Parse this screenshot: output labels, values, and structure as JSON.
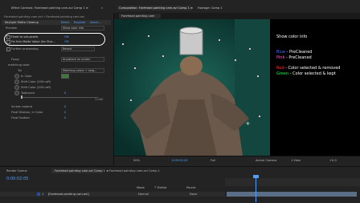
{
  "top_bar": {
    "left_tab": "Effect Controls: Forehead painting cam.avi Comp 1 ≡",
    "left_menu": "»",
    "comp_tab": "Composition: Forehead painting cam.avi Comp 1 ≡",
    "footage_tab": "Footage: Comp 1",
    "viewer_tab": "Forehead painting cam"
  },
  "effect": {
    "header": "Forehead painting cam.avi • Forehead painting cam.avi",
    "name": "Keylight Matte Cleanup",
    "reset": "Reset",
    "register": "Register",
    "about": "About...",
    "rows": [
      {
        "label": "Preview",
        "value": "Show color info"
      },
      {
        "label": "Fixed to sub-pixels",
        "value": "ON"
      },
      {
        "label": "Fix thin Matte Value (for Stro...",
        "value": "ON"
      },
      {
        "label": "Further processing",
        "value": "Reveal"
      },
      {
        "label": "Fuzzy",
        "value": "Anywhere on screen"
      },
      {
        "label": "matching color",
        "value": ""
      },
      {
        "label": "Tol",
        "value": "Matching colors + neig..."
      },
      {
        "label": "In Color",
        "value": ""
      },
      {
        "label": "Shift Color (200=off)",
        "value": ""
      },
      {
        "label": "Shift Color (200=off)",
        "value": ""
      },
      {
        "label": "Tolerance",
        "value": "0"
      },
      {
        "label": "",
        "value": "1.000"
      },
      {
        "label": "Screen extend",
        "value": "0"
      },
      {
        "label": "Final Dilation, in Color",
        "value": "0"
      },
      {
        "label": "Final Feather",
        "value": "0"
      }
    ]
  },
  "overlay": {
    "title": "Show color info",
    "items": [
      {
        "key": "Blue",
        "text": " - PreCleaned",
        "color": "#3f6bff"
      },
      {
        "key": "Pink",
        "text": " - PreCleaned",
        "color": "#ff5ac8"
      },
      {
        "key": "Red",
        "text": " - Color selected & removed",
        "color": "#ff2a2a"
      },
      {
        "key": "Green",
        "text": " - Color selected & kept",
        "color": "#2ee64b"
      }
    ]
  },
  "viewer_footer": {
    "zoom": "50%",
    "time": "0:00:02:05",
    "resolution": "Full",
    "camera": "Active Camera",
    "views": "1 View",
    "offset": "+0.0"
  },
  "timeline": {
    "tab1": "Render Queue",
    "tab2": "Forehead painting cam.avi Comp 1 ≡",
    "tab3": "Forehead painting cam.avi Comp 1",
    "timecode": "0:00:02:05",
    "layer_num": "1",
    "layer_name": "[Forehead painting cam.avi]",
    "mode": "Normal",
    "parent": "None",
    "col_mode": "Mode",
    "col_trk": "T TrkMat",
    "col_parent": "Parent"
  },
  "colors": {
    "accent_highlight": "#ffffff",
    "value_blue": "#4ea0ff",
    "viewer_bg": "#0f3a34"
  }
}
